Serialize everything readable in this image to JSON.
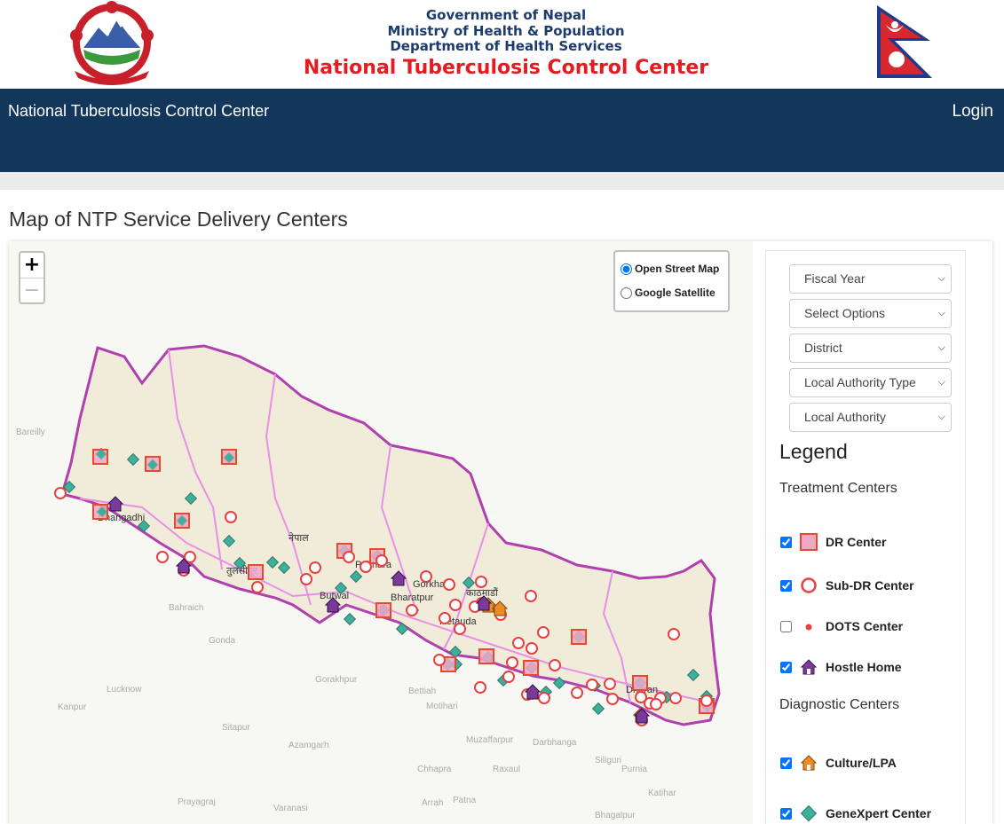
{
  "header": {
    "line1": "Government of Nepal",
    "line2": "Ministry of Health & Population",
    "line3": "Department of Health Services",
    "line4": "National Tuberculosis Control Center"
  },
  "nav": {
    "brand": "National Tuberculosis Control Center",
    "login": "Login"
  },
  "page_title": "Map of NTP Service Delivery Centers",
  "map": {
    "zoom_in": "+",
    "zoom_out": "−",
    "layers": [
      {
        "label": "Open Street Map",
        "checked": true
      },
      {
        "label": "Google Satellite",
        "checked": false
      }
    ],
    "place_labels": [
      {
        "text": "नेपाल"
      },
      {
        "text": "Pokhara"
      },
      {
        "text": "Gorkha"
      },
      {
        "text": "Bharatpur"
      },
      {
        "text": "Butwal"
      },
      {
        "text": "Hetauda"
      },
      {
        "text": "काठमाडौं"
      },
      {
        "text": "तुलसीपुर"
      },
      {
        "text": "Dhangadhi"
      },
      {
        "text": "Dharan"
      },
      {
        "text": "Lucknow"
      },
      {
        "text": "Kanpur"
      },
      {
        "text": "Gorakhpur"
      },
      {
        "text": "Bareilly"
      },
      {
        "text": "Prayagraj"
      },
      {
        "text": "Varanasi"
      },
      {
        "text": "Patna"
      },
      {
        "text": "Bhagalpur"
      },
      {
        "text": "Darbhanga"
      },
      {
        "text": "Muzaffarpur"
      },
      {
        "text": "Purnia"
      },
      {
        "text": "Siliguri"
      },
      {
        "text": "Motihari"
      },
      {
        "text": "Bettiah"
      },
      {
        "text": "Sitapur"
      },
      {
        "text": "Gonda"
      },
      {
        "text": "Bahraich"
      },
      {
        "text": "Azamgarh"
      },
      {
        "text": "Chhapra"
      },
      {
        "text": "Arrah"
      },
      {
        "text": "Raxaul"
      },
      {
        "text": "Katihar"
      }
    ]
  },
  "filters": {
    "fiscal_year": "Fiscal Year",
    "select_options": "Select Options",
    "district": "District",
    "local_authority_type": "Local Authority Type",
    "local_authority": "Local Authority"
  },
  "legend": {
    "title": "Legend",
    "treatment_title": "Treatment Centers",
    "diagnostic_title": "Diagnostic Centers",
    "items": [
      {
        "label": "DR Center",
        "checked": true,
        "icon": "dr-center-icon"
      },
      {
        "label": "Sub-DR Center",
        "checked": true,
        "icon": "sub-dr-center-icon"
      },
      {
        "label": "DOTS Center",
        "checked": false,
        "icon": "dots-center-icon"
      },
      {
        "label": "Hostle Home",
        "checked": true,
        "icon": "hostle-home-icon"
      },
      {
        "label": "Culture/LPA",
        "checked": true,
        "icon": "culture-lpa-icon"
      },
      {
        "label": "GeneXpert Center",
        "checked": true,
        "icon": "genexpert-center-icon"
      }
    ]
  },
  "colors": {
    "navbar": "#12375a",
    "title_red": "#e31b23",
    "gov_blue": "#1d3c6e",
    "dr_fill": "#f0a8c8",
    "dr_border": "#e8492a",
    "sub_dr": "#e84040",
    "hostel": "#7a3a9a",
    "culture": "#f08a24",
    "genexpert": "#3fae9a",
    "nepal_border": "#b040b0",
    "land": "#f1ecd9"
  }
}
